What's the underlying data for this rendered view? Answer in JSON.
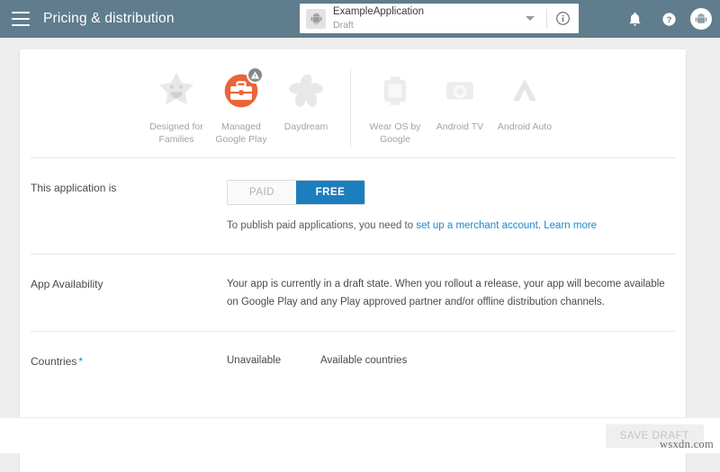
{
  "header": {
    "menu_icon": "hamburger-menu-icon",
    "title": "Pricing & distribution",
    "app_selector": {
      "icon": "android-app-icon",
      "name": "ExampleApplication",
      "state": "Draft",
      "caret_icon": "chevron-down-icon",
      "info_icon": "info-circle-icon"
    },
    "actions": [
      {
        "icon": "notifications-bell-icon",
        "name": "notifications-button"
      },
      {
        "icon": "help-question-icon",
        "name": "help-button"
      },
      {
        "icon": "account-avatar-icon",
        "name": "account-button"
      }
    ],
    "bar_color": "#5f7d8c"
  },
  "features": {
    "left": [
      {
        "id": "designed-for-families",
        "label": "Designed for\nFamilies",
        "icon": "smiling-star-icon",
        "state": "inactive"
      },
      {
        "id": "managed-google-play",
        "label": "Managed\nGoogle Play",
        "icon": "briefcase-circle-icon",
        "state": "active",
        "badge": "warning-triangle-icon",
        "accent": "#ec6437"
      },
      {
        "id": "daydream",
        "label": "Daydream",
        "icon": "pinwheel-icon",
        "state": "inactive"
      }
    ],
    "right": [
      {
        "id": "wear-os-by-google",
        "label": "Wear OS by\nGoogle",
        "icon": "smartwatch-icon",
        "state": "inactive"
      },
      {
        "id": "android-tv",
        "label": "Android TV",
        "icon": "television-icon",
        "state": "inactive"
      },
      {
        "id": "android-auto",
        "label": "Android Auto",
        "icon": "chevron-peak-icon",
        "state": "inactive"
      }
    ]
  },
  "sections": {
    "application_type": {
      "label": "This application is",
      "options": [
        {
          "value": "PAID",
          "selected": false
        },
        {
          "value": "FREE",
          "selected": true
        }
      ],
      "selected_value": "FREE",
      "helper_prefix": "To publish paid applications, you need to ",
      "helper_link_1": "set up a merchant account",
      "helper_middle": ". ",
      "helper_link_2": "Learn more",
      "accent_color": "#1b7fbd"
    },
    "app_availability": {
      "label": "App Availability",
      "text": "Your app is currently in a draft state. When you rollout a release, your app will become available on Google Play and any Play approved partner and/or offline distribution channels."
    },
    "countries": {
      "label": "Countries",
      "required_marker": "*",
      "columns": [
        "Unavailable",
        "Available countries"
      ]
    }
  },
  "footer": {
    "save_label": "SAVE DRAFT",
    "save_enabled": false
  },
  "watermark": "wsxdn.com"
}
